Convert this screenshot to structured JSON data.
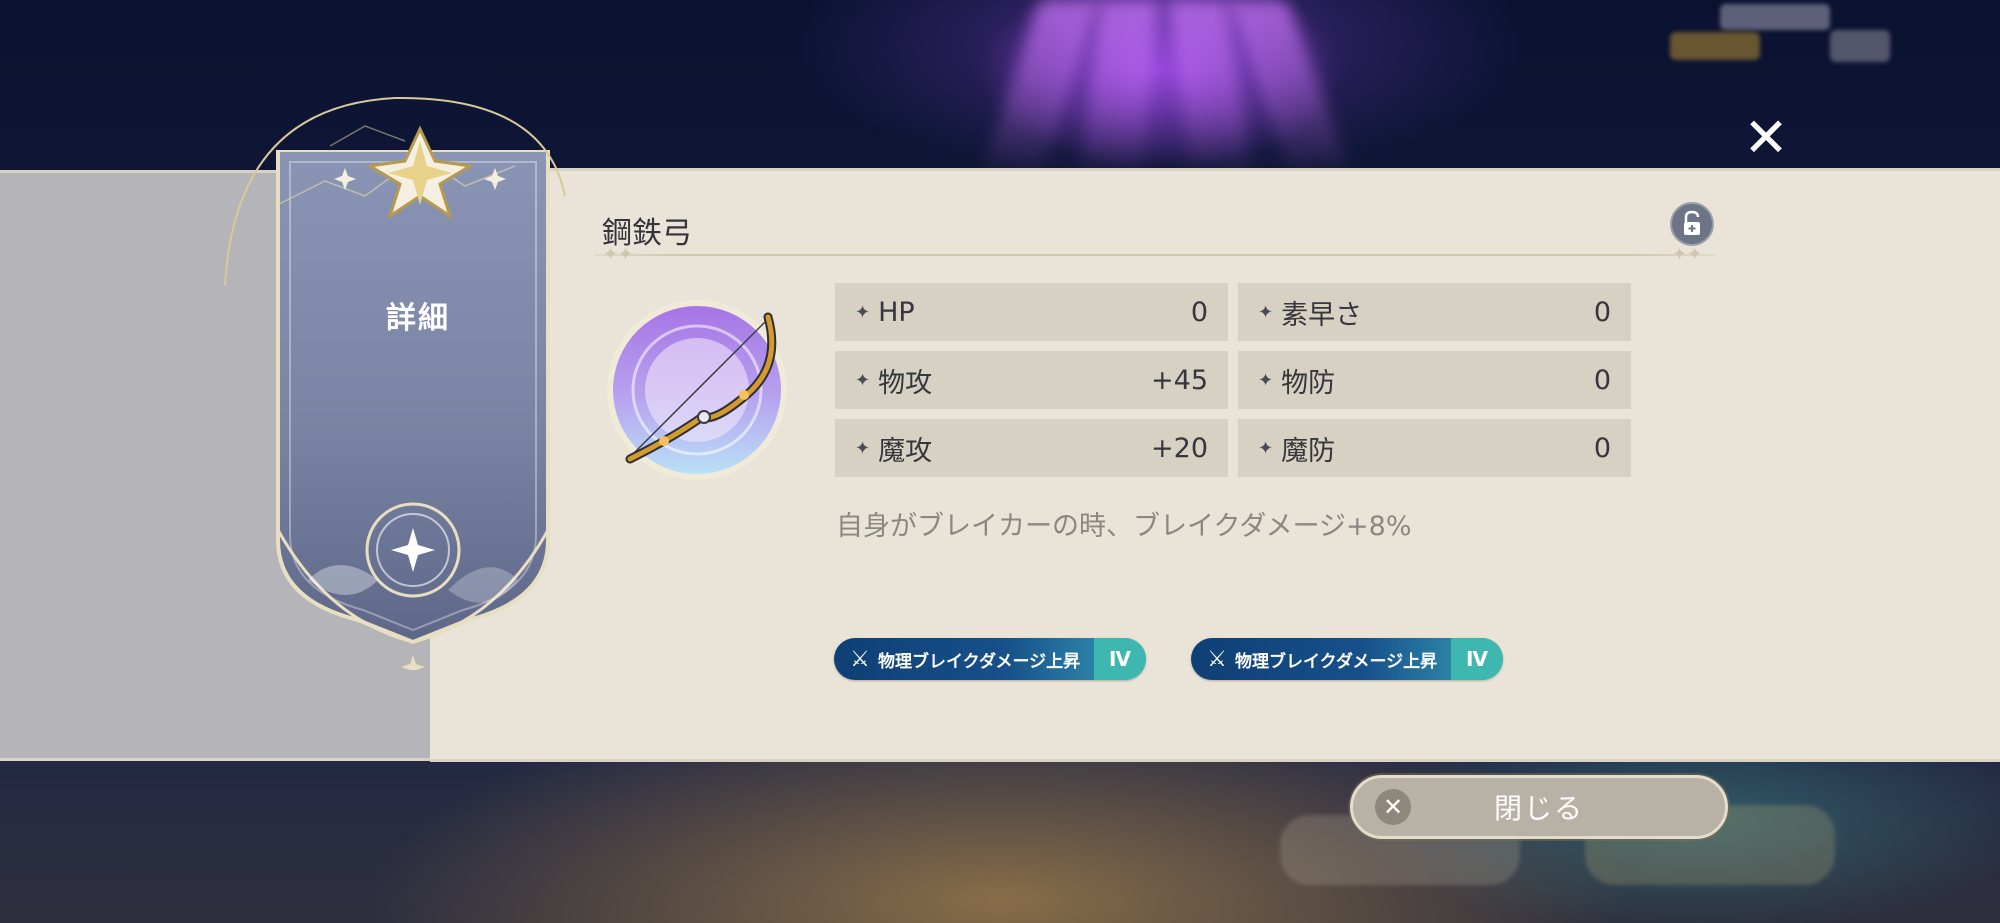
{
  "banner": {
    "label": "詳細"
  },
  "item": {
    "name": "鋼鉄弓",
    "icon": "bow-icon",
    "locked": false
  },
  "stats": [
    {
      "label": "HP",
      "value": "0"
    },
    {
      "label": "素早さ",
      "value": "0"
    },
    {
      "label": "物攻",
      "value": "+45"
    },
    {
      "label": "物防",
      "value": "0"
    },
    {
      "label": "魔攻",
      "value": "+20"
    },
    {
      "label": "魔防",
      "value": "0"
    }
  ],
  "effect": "自身がブレイカーの時、ブレイクダメージ+8%",
  "skills": [
    {
      "label": "物理ブレイクダメージ上昇",
      "level": "Ⅳ"
    },
    {
      "label": "物理ブレイクダメージ上昇",
      "level": "Ⅳ"
    }
  ],
  "close_button": {
    "label": "閉じる"
  },
  "close_icon": "✕",
  "colors": {
    "panel": "#e9e4d7",
    "stat_cell": "#d7d1c4",
    "skill_pill_start": "#0f3f74",
    "skill_pill_end": "#3bb4b0",
    "banner": "#7e88a8"
  }
}
